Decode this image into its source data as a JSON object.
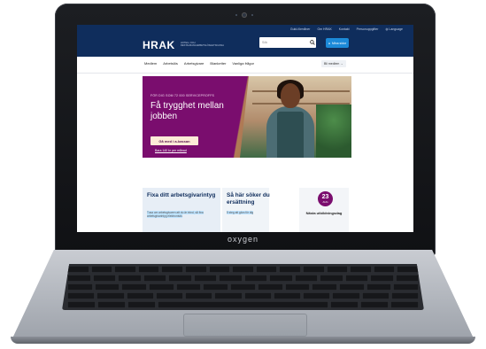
{
  "device": {
    "brand": "oxygen"
  },
  "utility_bar": {
    "items": [
      "Guld-förmåner",
      "Om HRAK",
      "Kontakt",
      "Personuppgifter",
      "Language"
    ]
  },
  "header": {
    "logo_text": "HRAK",
    "logo_subtitle": "HOTELL OCH RESTAURANGARBETSLÖSHETSKASSA",
    "search_placeholder": "Sök",
    "cta_label": "Mina sidor"
  },
  "nav": {
    "items": [
      "Medlem",
      "Arbetslös",
      "Arbetsgivare",
      "Blanketter",
      "Vanliga frågor"
    ],
    "right_label": "Bli medlem"
  },
  "hero": {
    "eyebrow": "FÖR DIG SOM 72 000 SERVICEPROFFS",
    "title": "Få trygghet mellan jobben",
    "button": "Gå med i a-kassan",
    "link": "Bara 140 kr per månad"
  },
  "cards": [
    {
      "title": "Fixa ditt arbetsgivarintyg",
      "text": "Tusa om arbetsgivaren att du är inlnd, så fixa arbetsgivarintyg elektroniskt."
    },
    {
      "title": "Så här söker du ersättning",
      "text": "5 steg att göra för dig"
    }
  ],
  "event": {
    "day": "23",
    "month": "AUG",
    "title": "Nästa utbildningsdag"
  },
  "colors": {
    "navy": "#0f2d5c",
    "accent_blue": "#1c8ad9",
    "purple": "#7a0d6e"
  }
}
